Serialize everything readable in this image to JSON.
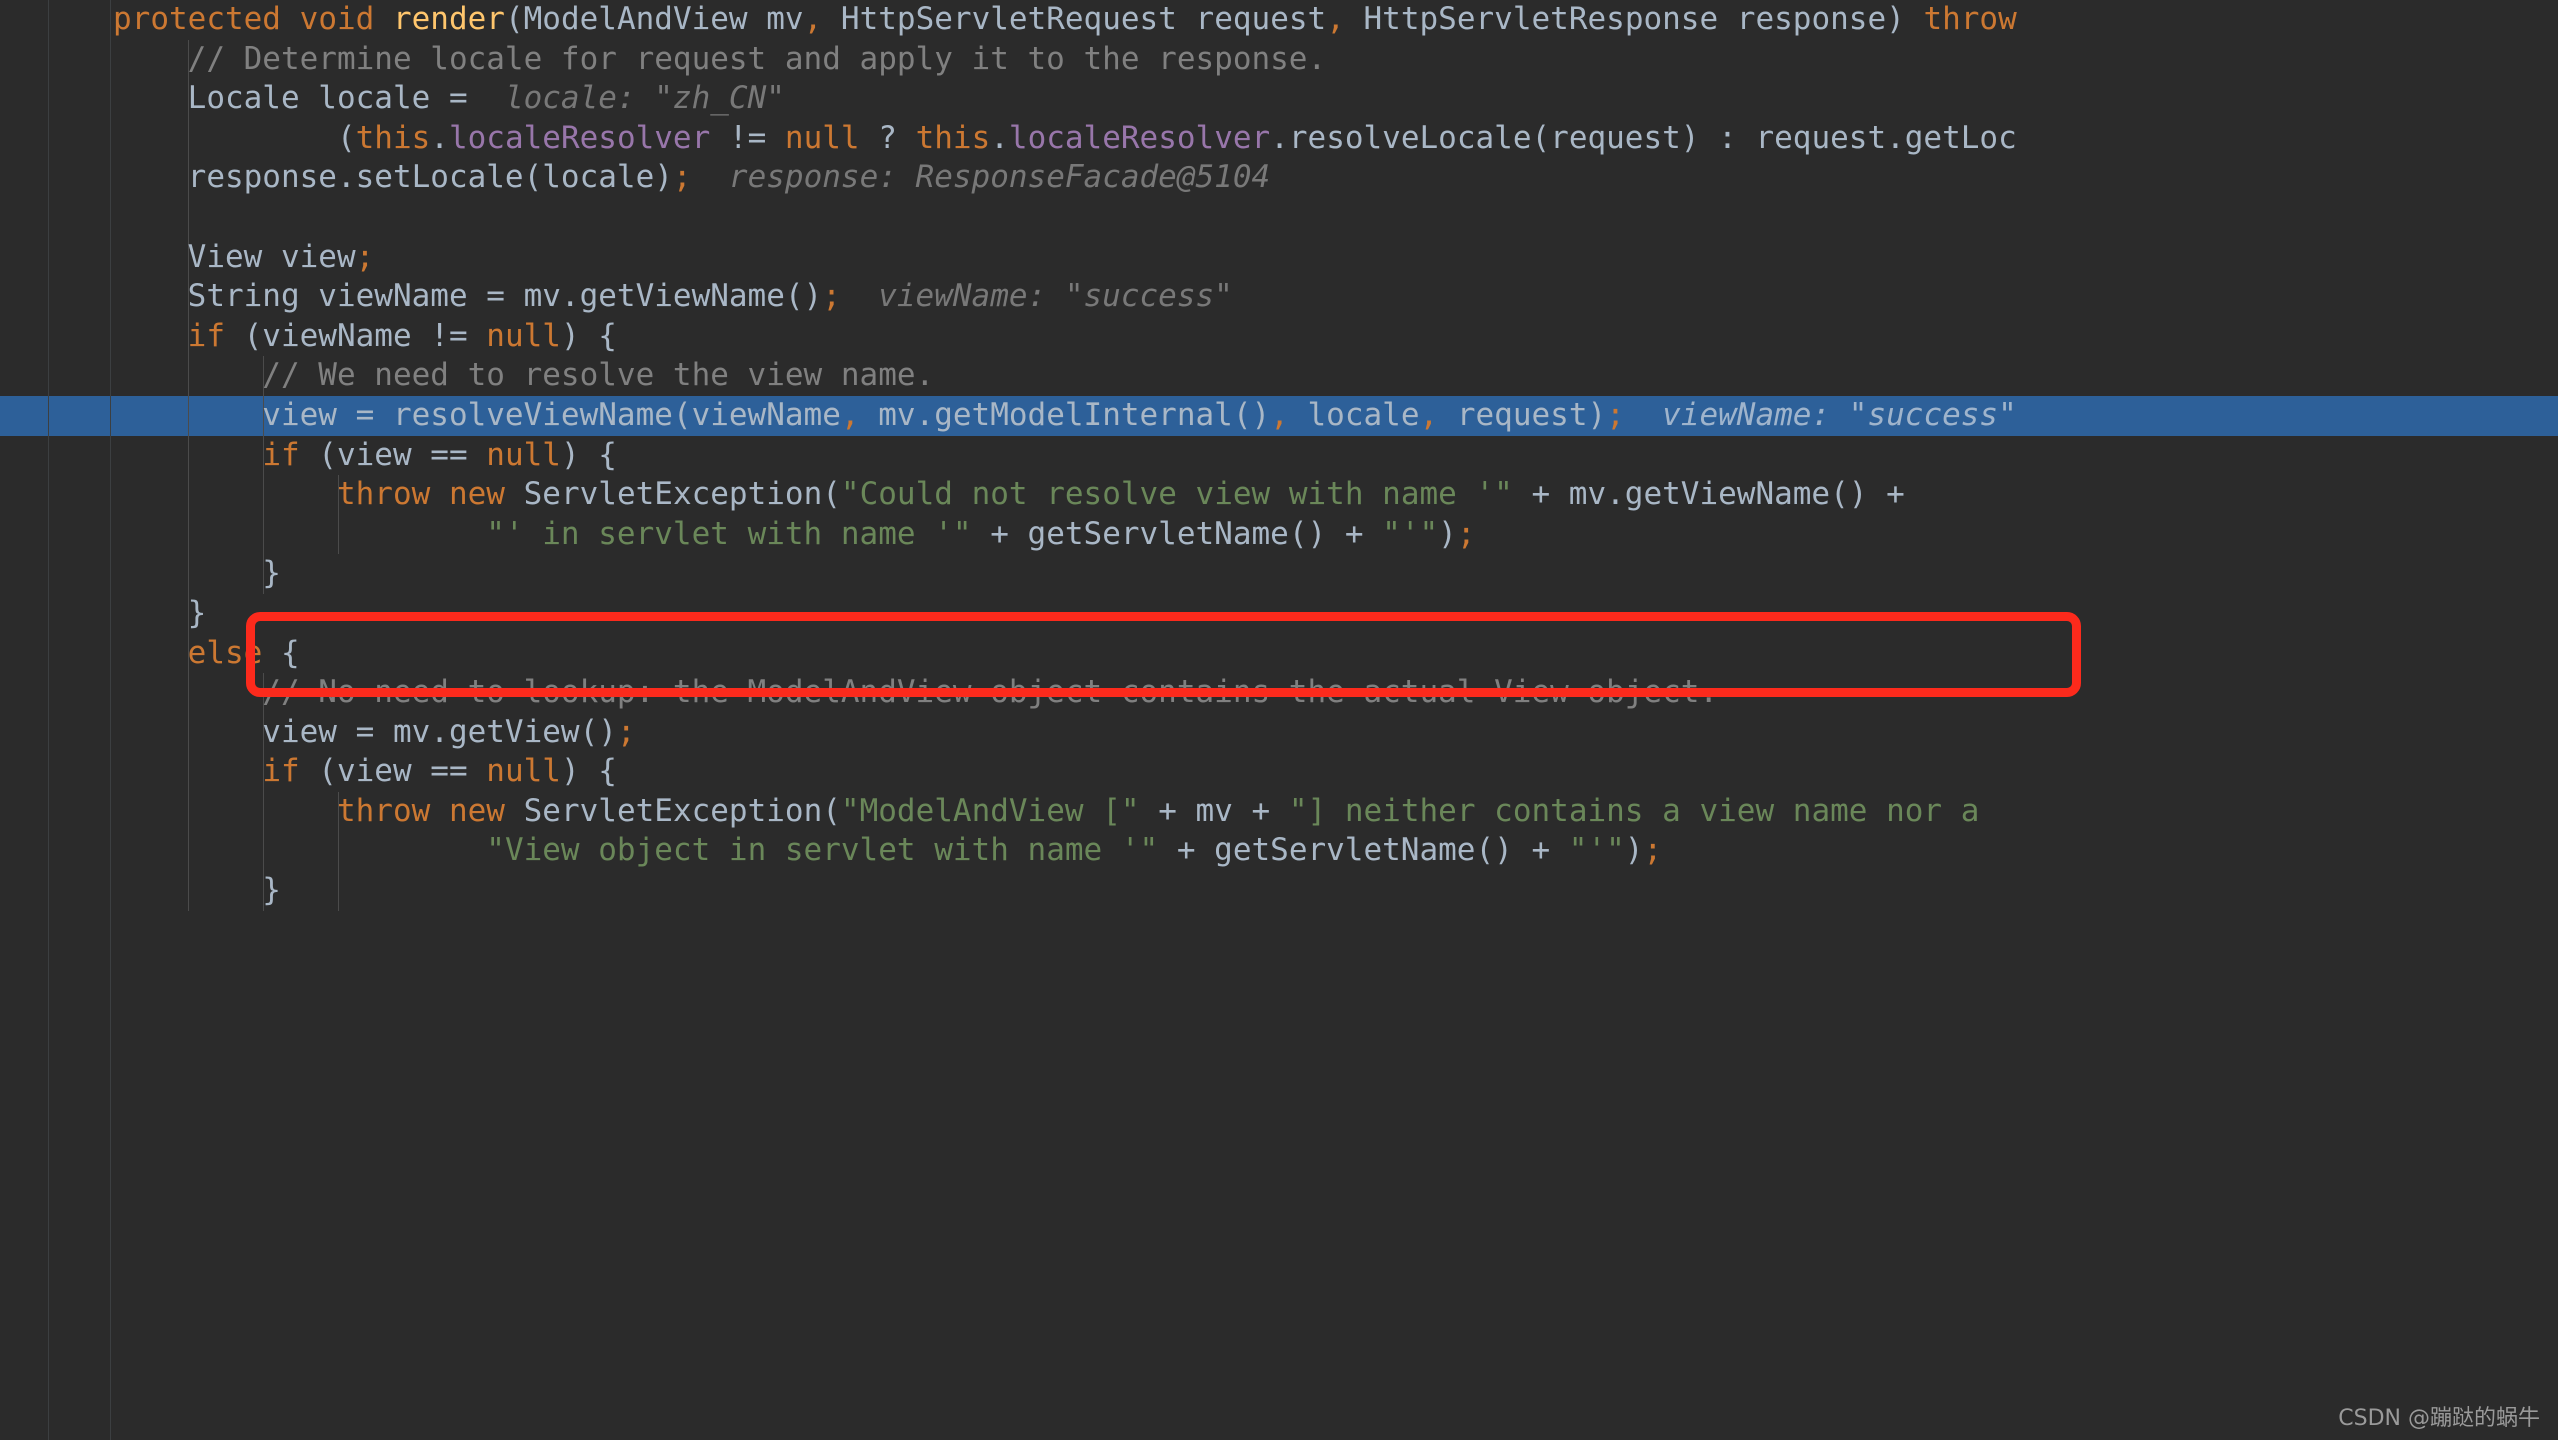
{
  "editor": {
    "language": "Java",
    "theme": "Darcula",
    "background_color": "#2b2b2b",
    "selection_color": "#2d6099",
    "default_text_color": "#a9b7c6",
    "keyword_color": "#cc7832",
    "field_color": "#9876aa",
    "string_color": "#6a8759",
    "comment_color": "#808080",
    "method_name_color": "#ffc66d",
    "inlay_hint_color": "#787878"
  },
  "annotation": {
    "shape": "rounded-rectangle",
    "color": "#fc2a1c",
    "target_line_index": 10,
    "target_text": "view = resolveViewName(viewName, mv.getModelInternal(), locale, request);"
  },
  "watermark": {
    "text": "CSDN @蹦跶的蜗牛"
  },
  "code": {
    "lines": [
      {
        "id": "line-1",
        "selected": false,
        "tokens": [
          {
            "t": "protected",
            "c": "kw"
          },
          {
            "t": " ",
            "c": "pln"
          },
          {
            "t": "void",
            "c": "kw"
          },
          {
            "t": " ",
            "c": "pln"
          },
          {
            "t": "render",
            "c": "fn"
          },
          {
            "t": "(ModelAndView mv",
            "c": "pln"
          },
          {
            "t": ",",
            "c": "semi"
          },
          {
            "t": " HttpServletRequest request",
            "c": "pln"
          },
          {
            "t": ",",
            "c": "semi"
          },
          {
            "t": " HttpServletResponse response) ",
            "c": "pln"
          },
          {
            "t": "throw",
            "c": "kw"
          }
        ],
        "indent": 0
      },
      {
        "id": "line-2",
        "selected": false,
        "tokens": [
          {
            "t": "    // Determine locale for request and apply it to the response.",
            "c": "cmt"
          }
        ],
        "indent": 1
      },
      {
        "id": "line-3",
        "selected": false,
        "tokens": [
          {
            "t": "    Locale locale = ",
            "c": "pln"
          },
          {
            "t": " locale: \"zh_CN\"",
            "c": "hint"
          }
        ],
        "indent": 1
      },
      {
        "id": "line-4",
        "selected": false,
        "tokens": [
          {
            "t": "            (",
            "c": "pln"
          },
          {
            "t": "this",
            "c": "kw"
          },
          {
            "t": ".",
            "c": "pln"
          },
          {
            "t": "localeResolver",
            "c": "fld"
          },
          {
            "t": " != ",
            "c": "pln"
          },
          {
            "t": "null",
            "c": "kw"
          },
          {
            "t": " ? ",
            "c": "pln"
          },
          {
            "t": "this",
            "c": "kw"
          },
          {
            "t": ".",
            "c": "pln"
          },
          {
            "t": "localeResolver",
            "c": "fld"
          },
          {
            "t": ".resolveLocale(request) : request.getLoc",
            "c": "pln"
          }
        ],
        "indent": 2
      },
      {
        "id": "line-5",
        "selected": false,
        "tokens": [
          {
            "t": "    response.setLocale(locale)",
            "c": "pln"
          },
          {
            "t": ";",
            "c": "semi"
          },
          {
            "t": "  response: ResponseFacade@5104",
            "c": "hint"
          }
        ],
        "indent": 1
      },
      {
        "id": "line-6",
        "selected": false,
        "tokens": [],
        "indent": 1
      },
      {
        "id": "line-7",
        "selected": false,
        "tokens": [
          {
            "t": "    View view",
            "c": "pln"
          },
          {
            "t": ";",
            "c": "semi"
          }
        ],
        "indent": 1
      },
      {
        "id": "line-8",
        "selected": false,
        "tokens": [
          {
            "t": "    String viewName = mv.getViewName()",
            "c": "pln"
          },
          {
            "t": ";",
            "c": "semi"
          },
          {
            "t": "  viewName: \"success\"",
            "c": "hint"
          }
        ],
        "indent": 1
      },
      {
        "id": "line-9",
        "selected": false,
        "tokens": [
          {
            "t": "    ",
            "c": "pln"
          },
          {
            "t": "if",
            "c": "kw"
          },
          {
            "t": " (viewName != ",
            "c": "pln"
          },
          {
            "t": "null",
            "c": "kw"
          },
          {
            "t": ") {",
            "c": "pln"
          }
        ],
        "indent": 1
      },
      {
        "id": "line-10",
        "selected": false,
        "tokens": [
          {
            "t": "        // We need to resolve the view name.",
            "c": "cmt"
          }
        ],
        "indent": 2
      },
      {
        "id": "line-11",
        "selected": true,
        "tokens": [
          {
            "t": "        view = resolveViewName(viewName",
            "c": "pln"
          },
          {
            "t": ",",
            "c": "semi"
          },
          {
            "t": " mv.getModelInternal()",
            "c": "pln"
          },
          {
            "t": ",",
            "c": "semi"
          },
          {
            "t": " locale",
            "c": "pln"
          },
          {
            "t": ",",
            "c": "semi"
          },
          {
            "t": " request)",
            "c": "pln"
          },
          {
            "t": ";",
            "c": "semi"
          },
          {
            "t": "  viewName: \"success\"",
            "c": "hint"
          }
        ],
        "indent": 2
      },
      {
        "id": "line-12",
        "selected": false,
        "tokens": [
          {
            "t": "        ",
            "c": "pln"
          },
          {
            "t": "if",
            "c": "kw"
          },
          {
            "t": " (view == ",
            "c": "pln"
          },
          {
            "t": "null",
            "c": "kw"
          },
          {
            "t": ") {",
            "c": "pln"
          }
        ],
        "indent": 2
      },
      {
        "id": "line-13",
        "selected": false,
        "tokens": [
          {
            "t": "            ",
            "c": "pln"
          },
          {
            "t": "throw",
            "c": "kw"
          },
          {
            "t": " ",
            "c": "pln"
          },
          {
            "t": "new",
            "c": "kw"
          },
          {
            "t": " ServletException(",
            "c": "pln"
          },
          {
            "t": "\"Could not resolve view with name '\"",
            "c": "str"
          },
          {
            "t": " + mv.getViewName() +",
            "c": "pln"
          }
        ],
        "indent": 3
      },
      {
        "id": "line-14",
        "selected": false,
        "tokens": [
          {
            "t": "                    ",
            "c": "pln"
          },
          {
            "t": "\"' in servlet with name '\"",
            "c": "str"
          },
          {
            "t": " + getServletName() + ",
            "c": "pln"
          },
          {
            "t": "\"'\"",
            "c": "str"
          },
          {
            "t": ")",
            "c": "pln"
          },
          {
            "t": ";",
            "c": "semi"
          }
        ],
        "indent": 4
      },
      {
        "id": "line-15",
        "selected": false,
        "tokens": [
          {
            "t": "        }",
            "c": "pln"
          }
        ],
        "indent": 2
      },
      {
        "id": "line-16",
        "selected": false,
        "tokens": [
          {
            "t": "    }",
            "c": "pln"
          }
        ],
        "indent": 1
      },
      {
        "id": "line-17",
        "selected": false,
        "tokens": [
          {
            "t": "    ",
            "c": "pln"
          },
          {
            "t": "else",
            "c": "kw"
          },
          {
            "t": " {",
            "c": "pln"
          }
        ],
        "indent": 1
      },
      {
        "id": "line-18",
        "selected": false,
        "tokens": [
          {
            "t": "        // No need to lookup: the ModelAndView object contains the actual View object.",
            "c": "cmt"
          }
        ],
        "indent": 2
      },
      {
        "id": "line-19",
        "selected": false,
        "tokens": [
          {
            "t": "        view = mv.getView()",
            "c": "pln"
          },
          {
            "t": ";",
            "c": "semi"
          }
        ],
        "indent": 2
      },
      {
        "id": "line-20",
        "selected": false,
        "tokens": [
          {
            "t": "        ",
            "c": "pln"
          },
          {
            "t": "if",
            "c": "kw"
          },
          {
            "t": " (view == ",
            "c": "pln"
          },
          {
            "t": "null",
            "c": "kw"
          },
          {
            "t": ") {",
            "c": "pln"
          }
        ],
        "indent": 2
      },
      {
        "id": "line-21",
        "selected": false,
        "tokens": [
          {
            "t": "            ",
            "c": "pln"
          },
          {
            "t": "throw",
            "c": "kw"
          },
          {
            "t": " ",
            "c": "pln"
          },
          {
            "t": "new",
            "c": "kw"
          },
          {
            "t": " ServletException(",
            "c": "pln"
          },
          {
            "t": "\"ModelAndView [\"",
            "c": "str"
          },
          {
            "t": " + mv + ",
            "c": "pln"
          },
          {
            "t": "\"] neither contains a view name nor a",
            "c": "str"
          }
        ],
        "indent": 3
      },
      {
        "id": "line-22",
        "selected": false,
        "tokens": [
          {
            "t": "                    ",
            "c": "pln"
          },
          {
            "t": "\"View object in servlet with name '\"",
            "c": "str"
          },
          {
            "t": " + getServletName() + ",
            "c": "pln"
          },
          {
            "t": "\"'\"",
            "c": "str"
          },
          {
            "t": ")",
            "c": "pln"
          },
          {
            "t": ";",
            "c": "semi"
          }
        ],
        "indent": 4
      },
      {
        "id": "line-23",
        "selected": false,
        "tokens": [
          {
            "t": "        }",
            "c": "pln"
          }
        ],
        "indent": 2
      }
    ]
  }
}
